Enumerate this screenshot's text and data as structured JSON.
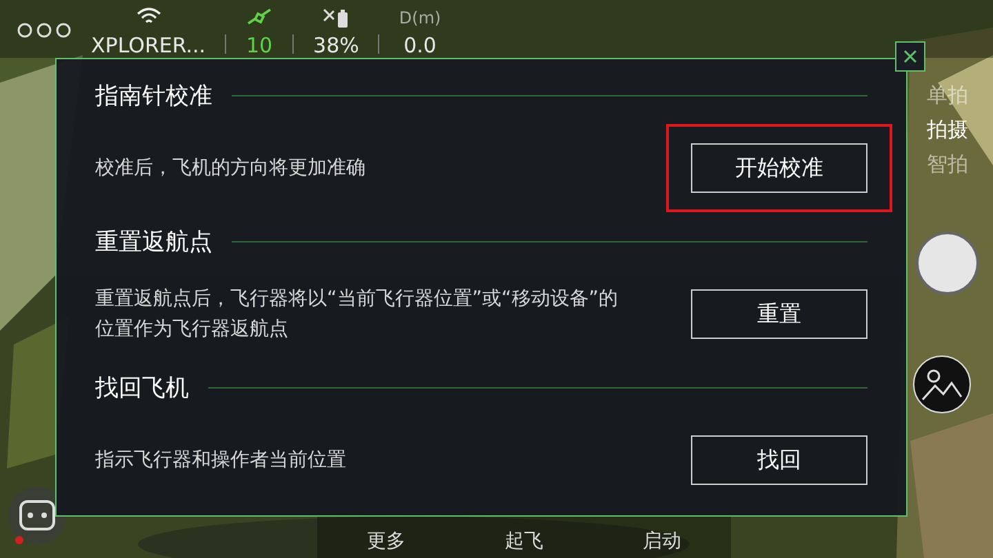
{
  "top_bar": {
    "network": "XPLORER...",
    "satellites": "10",
    "battery": "38%",
    "distance_label": "D(m)",
    "distance": "0.0"
  },
  "dialog": {
    "sections": [
      {
        "title": "指南针校准",
        "description": "校准后，飞机的方向将更加准确",
        "button": "开始校准",
        "highlighted": true
      },
      {
        "title": "重置返航点",
        "description": "重置返航点后，飞行器将以“当前飞行器位置”或“移动设备”的位置作为飞行器返航点",
        "button": "重置",
        "highlighted": false
      },
      {
        "title": "找回飞机",
        "description": "指示飞行器和操作者当前位置",
        "button": "找回",
        "highlighted": false
      }
    ]
  },
  "modes": [
    {
      "label": "单拍",
      "selected": false
    },
    {
      "label": "拍摄",
      "selected": true
    },
    {
      "label": "智拍",
      "selected": false
    }
  ],
  "bottom_actions": [
    "更多",
    "起飞",
    "启动"
  ]
}
